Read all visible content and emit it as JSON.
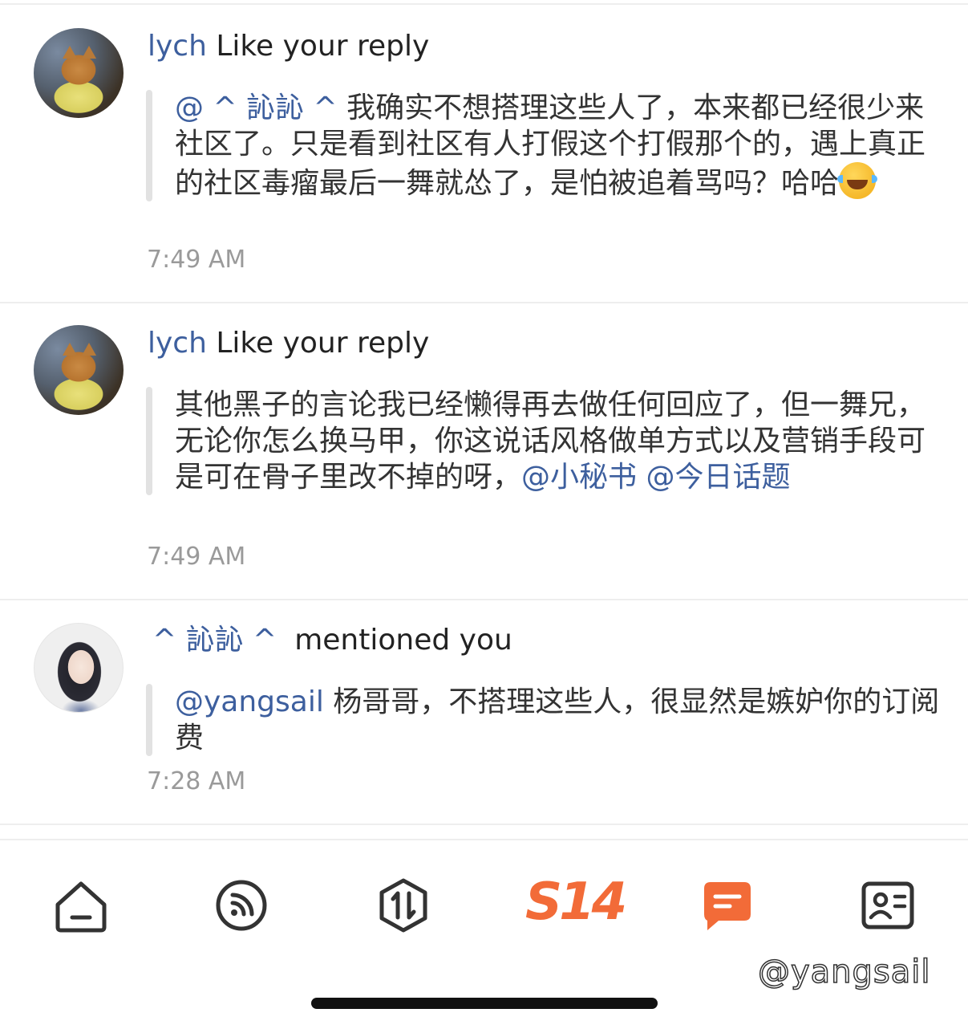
{
  "notifications": [
    {
      "user": "lych",
      "action": " Like your reply",
      "quote_mention": "@ ^ 訫訫 ^",
      "quote_text": "  我确实不想搭理这些人了，本来都已经很少来社区了。只是看到社区有人打假这个打假那个的，遇上真正的社区毒瘤最后一舞就怂了，是怕被追着骂吗？哈哈",
      "emoji": "face-with-tears-of-joy",
      "time": "7:49 AM"
    },
    {
      "user": "lych",
      "action": " Like your reply",
      "quote_text": "其他黑子的言论我已经懒得再去做任何回应了，但一舞兄，无论你怎么换马甲，你这说话风格做单方式以及营销手段可是可在骨子里改不掉的呀，",
      "quote_mention_1": "@小秘书",
      "quote_mention_2": " @今日话题",
      "time": "7:49 AM"
    },
    {
      "user": "^ 訫訫 ^",
      "action": "mentioned you",
      "quote_mention": "@yangsail",
      "quote_text": " 杨哥哥，不搭理这些人，很显然是嫉妒你的订阅费",
      "time": "7:28 AM"
    }
  ],
  "tabbar": {
    "tabs": [
      "home",
      "feed",
      "sort",
      "S14",
      "messages",
      "profile"
    ],
    "s14_label": "S14",
    "active_color": "#f26b38",
    "inactive_color": "#333333"
  },
  "watermark": "@yangsail",
  "colors": {
    "mention": "#3d5f9e",
    "accent": "#f26b38"
  }
}
